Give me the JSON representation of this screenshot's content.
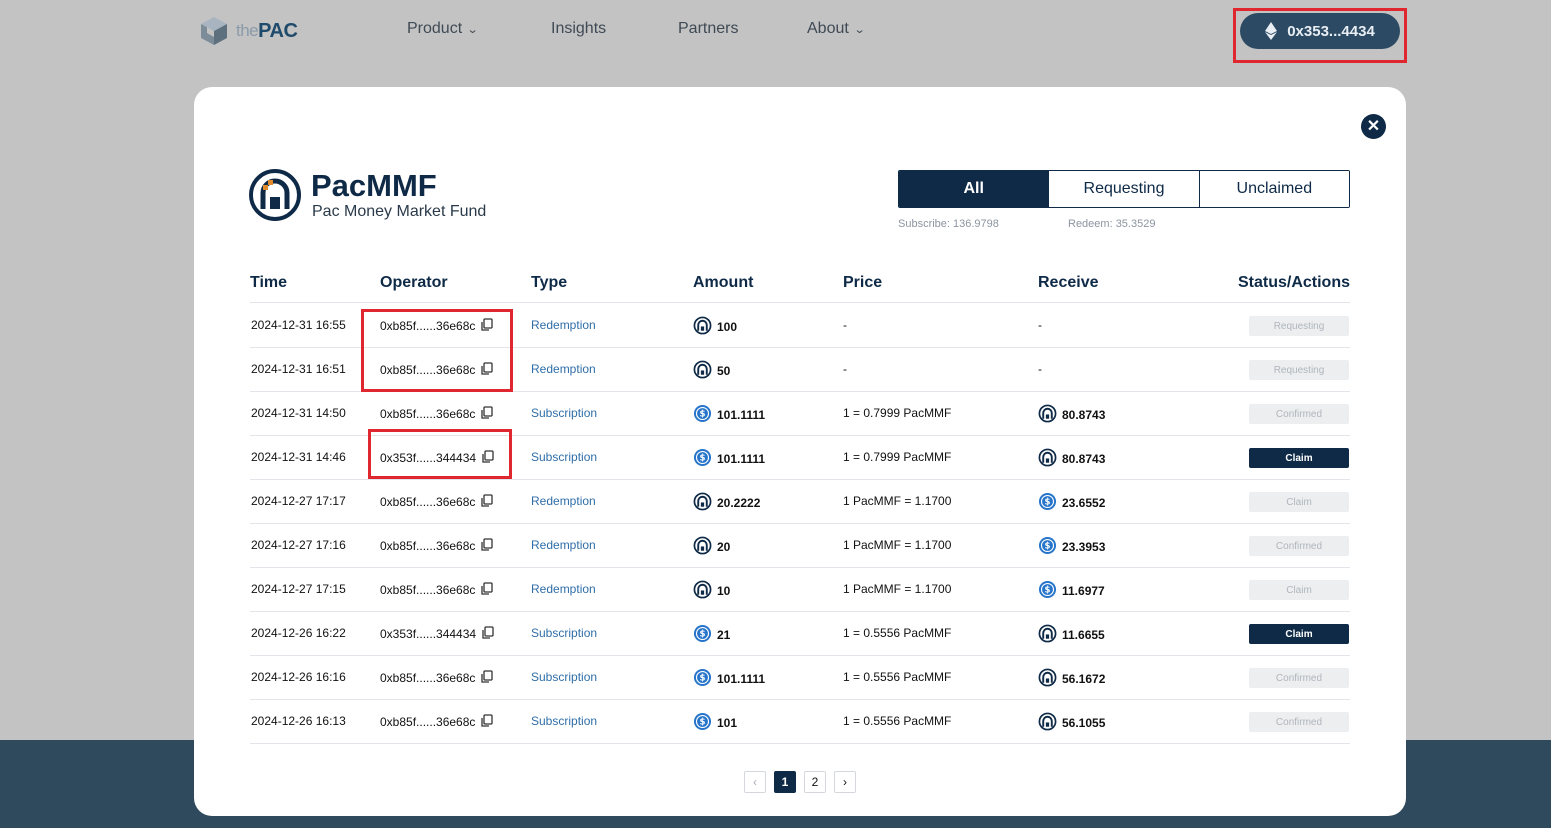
{
  "header": {
    "logo_the": "the",
    "logo_pac": "PAC",
    "nav": [
      {
        "label": "Product",
        "dropdown": true
      },
      {
        "label": "Insights",
        "dropdown": false
      },
      {
        "label": "Partners",
        "dropdown": false
      },
      {
        "label": "About",
        "dropdown": true
      }
    ],
    "wallet_address": "0x353...4434"
  },
  "modal": {
    "fund_title": "PacMMF",
    "fund_subtitle": "Pac Money Market Fund",
    "tabs": [
      {
        "label": "All",
        "active": true
      },
      {
        "label": "Requesting",
        "active": false
      },
      {
        "label": "Unclaimed",
        "active": false
      }
    ],
    "subscribe": "Subscribe: 136.9798",
    "redeem": "Redeem: 35.3529",
    "columns": [
      "Time",
      "Operator",
      "Type",
      "Amount",
      "Price",
      "Receive",
      "Status/Actions"
    ],
    "rows": [
      {
        "time": "2024-12-31 16:55",
        "operator": "0xb85f......36e68c",
        "type": "Redemption",
        "amount_coin": "pac",
        "amount": "100",
        "price": "-",
        "receive_coin": "",
        "receive": "-",
        "status": "Requesting",
        "status_active": false
      },
      {
        "time": "2024-12-31 16:51",
        "operator": "0xb85f......36e68c",
        "type": "Redemption",
        "amount_coin": "pac",
        "amount": "50",
        "price": "-",
        "receive_coin": "",
        "receive": "-",
        "status": "Requesting",
        "status_active": false
      },
      {
        "time": "2024-12-31 14:50",
        "operator": "0xb85f......36e68c",
        "type": "Subscription",
        "amount_coin": "usdc",
        "amount": "101.1111",
        "price": "1 = 0.7999 PacMMF",
        "receive_coin": "pac",
        "receive": "80.8743",
        "status": "Confirmed",
        "status_active": false
      },
      {
        "time": "2024-12-31 14:46",
        "operator": "0x353f......344434",
        "type": "Subscription",
        "amount_coin": "usdc",
        "amount": "101.1111",
        "price": "1 = 0.7999 PacMMF",
        "receive_coin": "pac",
        "receive": "80.8743",
        "status": "Claim",
        "status_active": true
      },
      {
        "time": "2024-12-27 17:17",
        "operator": "0xb85f......36e68c",
        "type": "Redemption",
        "amount_coin": "pac",
        "amount": "20.2222",
        "price": "1 PacMMF = 1.1700",
        "receive_coin": "usdc",
        "receive": "23.6552",
        "status": "Claim",
        "status_active": false
      },
      {
        "time": "2024-12-27 17:16",
        "operator": "0xb85f......36e68c",
        "type": "Redemption",
        "amount_coin": "pac",
        "amount": "20",
        "price": "1 PacMMF = 1.1700",
        "receive_coin": "usdc",
        "receive": "23.3953",
        "status": "Confirmed",
        "status_active": false
      },
      {
        "time": "2024-12-27 17:15",
        "operator": "0xb85f......36e68c",
        "type": "Redemption",
        "amount_coin": "pac",
        "amount": "10",
        "price": "1 PacMMF = 1.1700",
        "receive_coin": "usdc",
        "receive": "11.6977",
        "status": "Claim",
        "status_active": false
      },
      {
        "time": "2024-12-26 16:22",
        "operator": "0x353f......344434",
        "type": "Subscription",
        "amount_coin": "usdc",
        "amount": "21",
        "price": "1 = 0.5556 PacMMF",
        "receive_coin": "pac",
        "receive": "11.6655",
        "status": "Claim",
        "status_active": true
      },
      {
        "time": "2024-12-26 16:16",
        "operator": "0xb85f......36e68c",
        "type": "Subscription",
        "amount_coin": "usdc",
        "amount": "101.1111",
        "price": "1 = 0.5556 PacMMF",
        "receive_coin": "pac",
        "receive": "56.1672",
        "status": "Confirmed",
        "status_active": false
      },
      {
        "time": "2024-12-26 16:13",
        "operator": "0xb85f......36e68c",
        "type": "Subscription",
        "amount_coin": "usdc",
        "amount": "101",
        "price": "1 = 0.5556 PacMMF",
        "receive_coin": "pac",
        "receive": "56.1055",
        "status": "Confirmed",
        "status_active": false
      }
    ],
    "pagination": {
      "prev": "‹",
      "pages": [
        "1",
        "2"
      ],
      "current": "1",
      "next": "›"
    }
  },
  "colors": {
    "navy": "#0e2a47",
    "link": "#2f6ea8",
    "highlight": "#e0262f",
    "usdc": "#2775ca"
  }
}
